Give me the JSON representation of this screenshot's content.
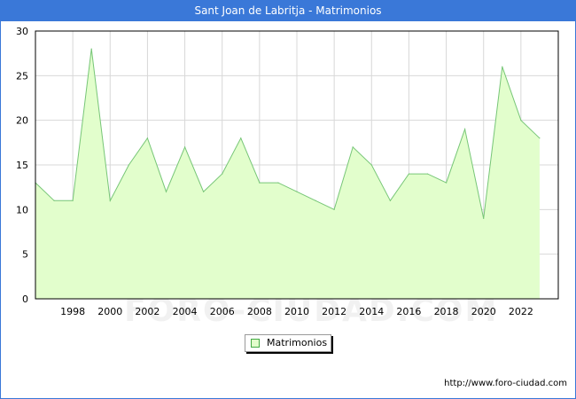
{
  "title": "Sant Joan de Labritja - Matrimonios",
  "watermark": "FORO-CIUDAD.COM",
  "source": "http://www.foro-ciudad.com",
  "colors": {
    "header": "#3a78d8",
    "area_fill": "#e2fecc",
    "line": "#77c677",
    "grid": "#d8d8d8"
  },
  "chart_data": {
    "type": "area",
    "title": "Sant Joan de Labritja - Matrimonios",
    "xlabel": "",
    "ylabel": "",
    "x": [
      1996,
      1997,
      1998,
      1999,
      2000,
      2001,
      2002,
      2003,
      2004,
      2005,
      2006,
      2007,
      2008,
      2009,
      2010,
      2011,
      2012,
      2013,
      2014,
      2015,
      2016,
      2017,
      2018,
      2019,
      2020,
      2021,
      2022,
      2023
    ],
    "series": [
      {
        "name": "Matrimonios",
        "values": [
          13,
          11,
          11,
          28,
          11,
          15,
          18,
          12,
          17,
          12,
          14,
          18,
          13,
          13,
          12,
          11,
          10,
          17,
          15,
          11,
          14,
          14,
          13,
          19,
          9,
          26,
          20,
          18
        ]
      }
    ],
    "x_ticks": [
      "1998",
      "2000",
      "2002",
      "2004",
      "2006",
      "2008",
      "2010",
      "2012",
      "2014",
      "2016",
      "2018",
      "2020",
      "2022"
    ],
    "y_ticks": [
      "0",
      "5",
      "10",
      "15",
      "20",
      "25",
      "30"
    ],
    "xlim": [
      1996,
      2024
    ],
    "ylim": [
      0,
      30
    ],
    "grid": true,
    "legend": "bottom-center"
  }
}
